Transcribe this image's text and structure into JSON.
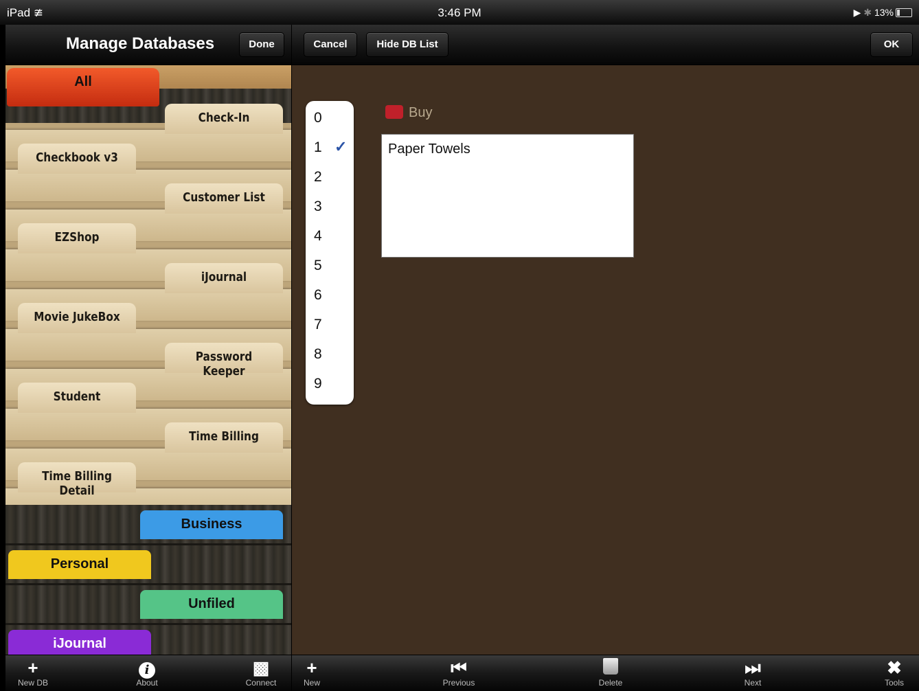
{
  "status_bar": {
    "device": "iPad",
    "time": "3:46 PM",
    "battery": "13%"
  },
  "left_nav": {
    "title": "Manage Databases",
    "done_label": "Done"
  },
  "right_nav": {
    "cancel_label": "Cancel",
    "hide_label": "Hide DB List",
    "ok_label": "OK"
  },
  "databases": {
    "all_label": "All",
    "items": [
      {
        "label": "Check-In",
        "side": "right"
      },
      {
        "label": "Checkbook v3",
        "side": "left"
      },
      {
        "label": "Customer List",
        "side": "right"
      },
      {
        "label": "EZShop",
        "side": "left"
      },
      {
        "label": "iJournal",
        "side": "right"
      },
      {
        "label": "Movie JukeBox",
        "side": "left"
      },
      {
        "label": "Password Keeper",
        "side": "right"
      },
      {
        "label": "Student",
        "side": "left"
      },
      {
        "label": "Time Billing",
        "side": "right"
      },
      {
        "label": "Time Billing Detail",
        "side": "left"
      }
    ],
    "categories": [
      {
        "label": "Business",
        "color": "#3c9be6"
      },
      {
        "label": "Personal",
        "color": "#f0c81e"
      },
      {
        "label": "Unfiled",
        "color": "#55c487"
      },
      {
        "label": "iJournal",
        "color": "#8a2bd6"
      }
    ]
  },
  "record": {
    "picker_values": [
      "0",
      "1",
      "2",
      "3",
      "4",
      "5",
      "6",
      "7",
      "8",
      "9"
    ],
    "selected_index": 1,
    "checkbox_label": "Buy",
    "checkbox_color": "#c0202a",
    "note_text": "Paper Towels"
  },
  "left_toolbar": {
    "new_db_label": "New DB",
    "about_label": "About",
    "connect_label": "Connect"
  },
  "right_toolbar": {
    "new_label": "New",
    "previous_label": "Previous",
    "delete_label": "Delete",
    "next_label": "Next",
    "tools_label": "Tools"
  }
}
